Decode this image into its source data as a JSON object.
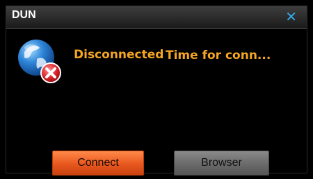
{
  "window": {
    "title": "DUN",
    "close_glyph": "✕"
  },
  "status": {
    "icon": "globe-disconnected-icon",
    "state": "Disconnected",
    "message": "Time for conn..."
  },
  "buttons": {
    "connect_label": "Connect",
    "browser_label": "Browser"
  },
  "colors": {
    "accent_text": "#f5a623",
    "close_icon": "#35a6e6",
    "connect_button": "#e8571e",
    "browser_button": "#6a6a6a"
  }
}
